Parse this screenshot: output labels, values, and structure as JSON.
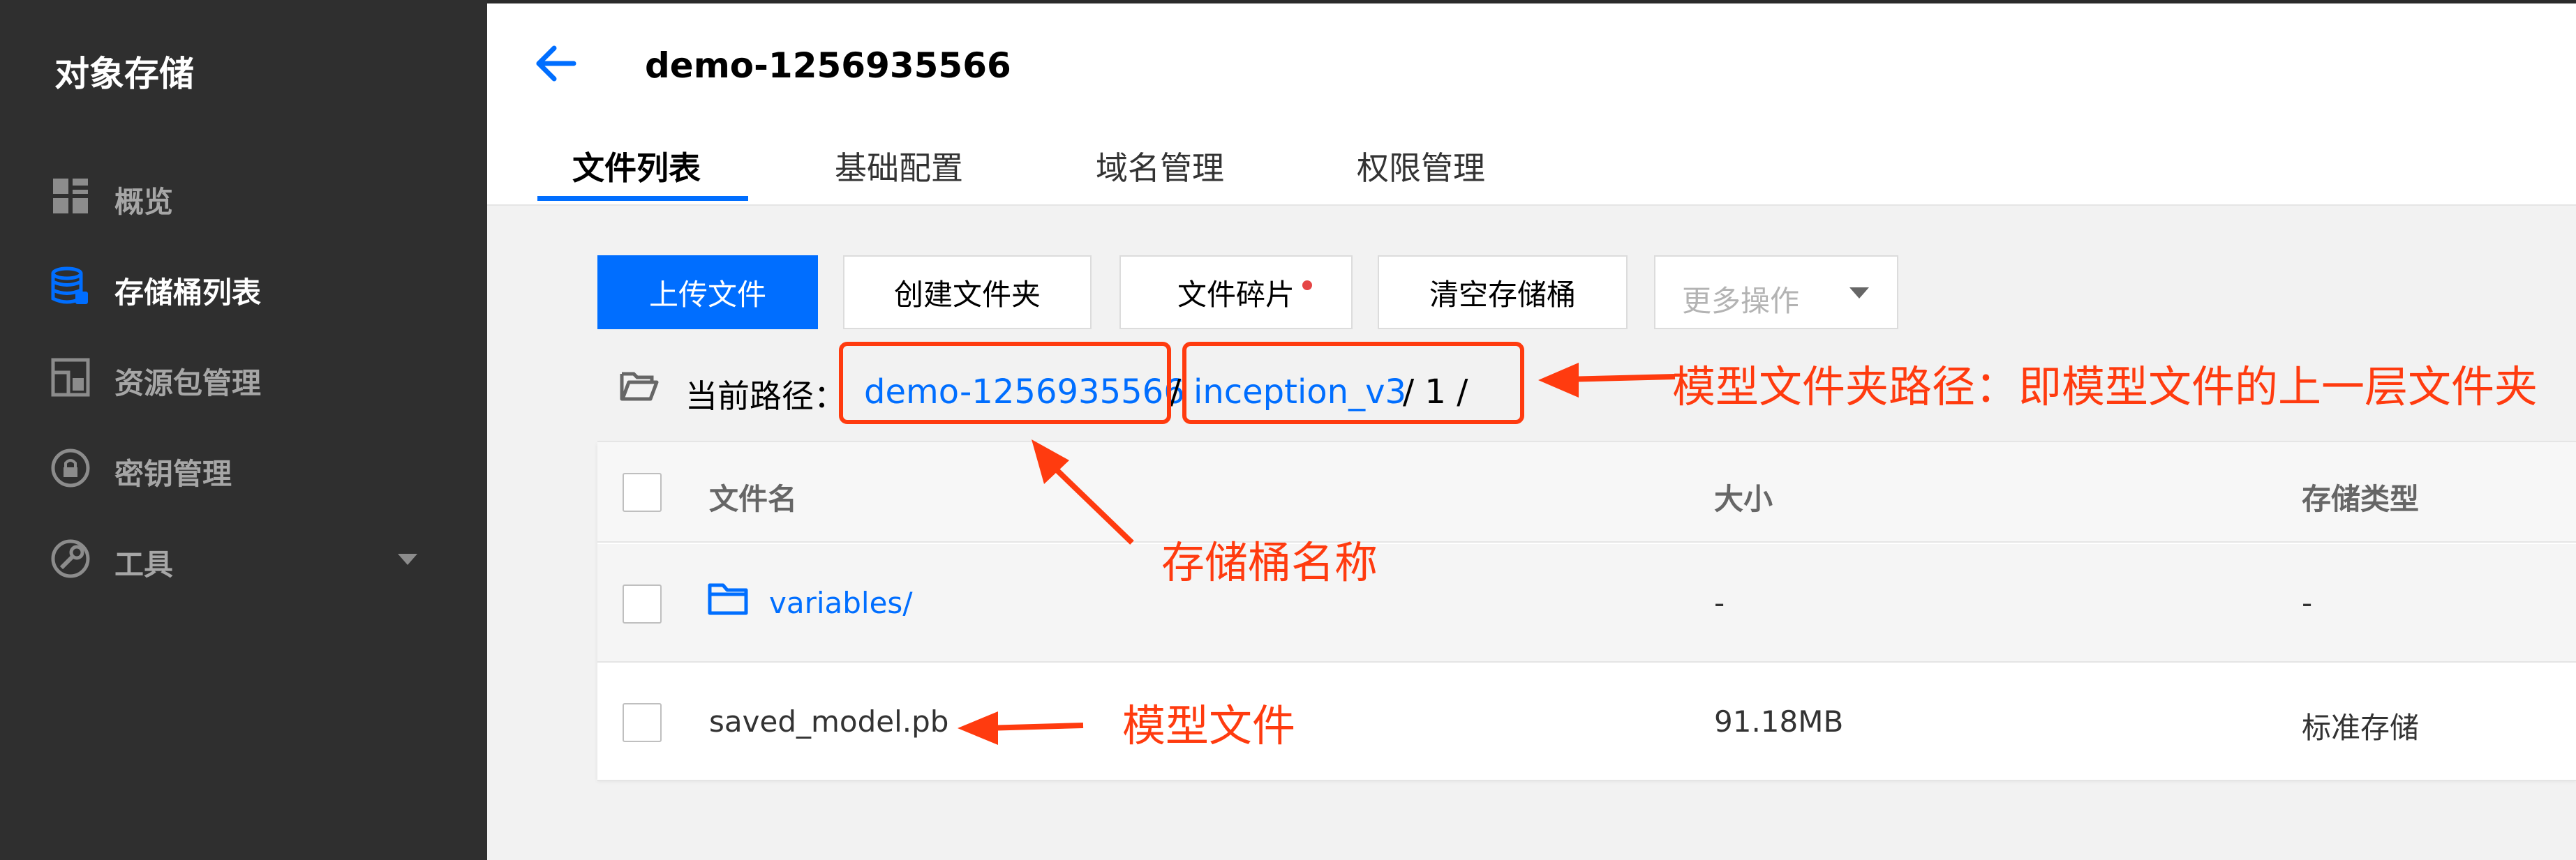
{
  "sidebar": {
    "title": "对象存储",
    "items": [
      {
        "label": "概览",
        "icon": "dashboard-grid-icon",
        "active": false
      },
      {
        "label": "存储桶列表",
        "icon": "database-bucket-icon",
        "active": true
      },
      {
        "label": "资源包管理",
        "icon": "resource-package-icon",
        "active": false
      },
      {
        "label": "密钥管理",
        "icon": "key-lock-icon",
        "active": false
      },
      {
        "label": "工具",
        "icon": "tools-icon",
        "active": false,
        "has_submenu": true
      }
    ]
  },
  "header": {
    "back_icon": "arrow-left-icon",
    "bucket_name": "demo-1256935566",
    "tabs": [
      {
        "label": "文件列表",
        "active": true
      },
      {
        "label": "基础配置",
        "active": false
      },
      {
        "label": "域名管理",
        "active": false
      },
      {
        "label": "权限管理",
        "active": false
      }
    ]
  },
  "toolbar": {
    "upload": "上传文件",
    "create_folder": "创建文件夹",
    "fragments": "文件碎片",
    "empty_bucket": "清空存储桶",
    "more_actions": "更多操作"
  },
  "path": {
    "label": "当前路径：",
    "bucket": "demo-1256935566",
    "sep1": "/",
    "folder": "inception_v3",
    "rest": "/ 1 /"
  },
  "table": {
    "columns": [
      "文件名",
      "大小",
      "存储类型"
    ],
    "rows": [
      {
        "name": "variables/",
        "size": "-",
        "storage": "-",
        "is_folder": true
      },
      {
        "name": "saved_model.pb",
        "size": "91.18MB",
        "storage": "标准存储",
        "is_folder": false
      }
    ]
  },
  "annotations": {
    "folder_path": "模型文件夹路径：即模型文件的上一层文件夹",
    "bucket_name": "存储桶名称",
    "model_file": "模型文件"
  },
  "colors": {
    "accent": "#006eff",
    "sidebar_bg": "#2f2f2f",
    "annotation": "#ff3b0f",
    "badge_dot": "#e54545"
  }
}
